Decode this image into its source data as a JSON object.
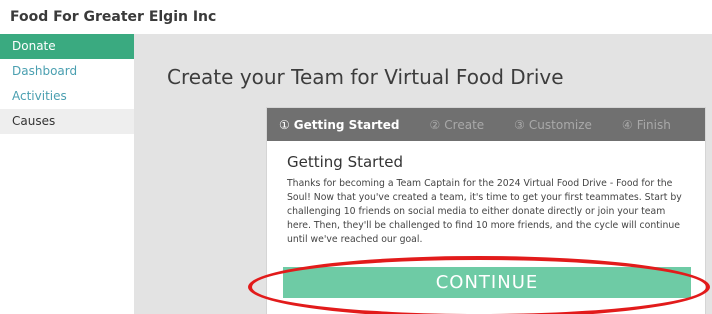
{
  "header": {
    "org_name": "Food For Greater Elgin Inc"
  },
  "sidebar": {
    "items": [
      {
        "label": "Donate"
      },
      {
        "label": "Dashboard"
      },
      {
        "label": "Activities"
      },
      {
        "label": "Causes"
      }
    ]
  },
  "main": {
    "heading": "Create your Team for Virtual Food Drive",
    "wizard": {
      "steps": [
        {
          "num": "①",
          "label": "Getting Started"
        },
        {
          "num": "②",
          "label": "Create"
        },
        {
          "num": "③",
          "label": "Customize"
        },
        {
          "num": "④",
          "label": "Finish"
        }
      ],
      "title": "Getting Started",
      "body": "Thanks for becoming a Team Captain for the 2024 Virtual Food Drive - Food for the Soul! Now that you've created a team, it's time to get your first teammates. Start by challenging 10 friends on social media to either donate directly or join your team here. Then, they'll be challenged to find 10 more friends, and the cycle will continue until we've reached our goal.",
      "continue_label": "CONTINUE"
    }
  },
  "colors": {
    "sidebar_active": "#3aaa80",
    "sidebar_link": "#4a9fb0",
    "continue_button": "#6ecba5",
    "annotation": "#e21b1b"
  }
}
